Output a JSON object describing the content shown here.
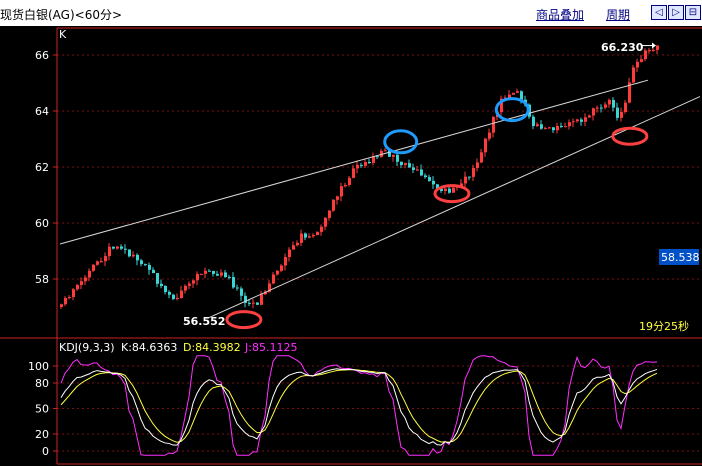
{
  "header": {
    "title": "现货白银(AG)<60分>",
    "overlay_label": "商品叠加",
    "period_label": "周期",
    "nav_left_icon": "◁",
    "nav_right_icon": "▷",
    "nav_fit_icon": "⊟"
  },
  "colors": {
    "background": "#000000",
    "up": "#ff3b3b",
    "down": "#3ad6d6",
    "axis": "#cc2222",
    "grid": "#7a1010",
    "channel": "#d8d8d8",
    "marker_red": "#ff4040",
    "marker_blue": "#1e9bff",
    "k_line": "#ffffff",
    "d_line": "#ffff40",
    "j_line": "#ff30ff",
    "price_box": "#0050c8"
  },
  "chart_data": [
    {
      "type": "candlestick",
      "panel_label": "K",
      "y_ticks": [
        58,
        60,
        62,
        64,
        66
      ],
      "ylim": [
        56.3,
        66.6
      ],
      "grid": true,
      "bar_count": 150,
      "close_path": [
        [
          0,
          57.0
        ],
        [
          6,
          57.9
        ],
        [
          12,
          58.6
        ],
        [
          17,
          59.2
        ],
        [
          21,
          59.0
        ],
        [
          27,
          58.6
        ],
        [
          33,
          57.8
        ],
        [
          37,
          57.2
        ],
        [
          41,
          57.6
        ],
        [
          46,
          58.3
        ],
        [
          52,
          58.2
        ],
        [
          56,
          58.0
        ],
        [
          60,
          57.5
        ],
        [
          63,
          57.0
        ],
        [
          66,
          57.2
        ],
        [
          70,
          58.0
        ],
        [
          75,
          58.8
        ],
        [
          80,
          59.5
        ],
        [
          86,
          59.6
        ],
        [
          92,
          61.0
        ],
        [
          98,
          62.0
        ],
        [
          103,
          62.2
        ],
        [
          108,
          62.6
        ],
        [
          113,
          62.2
        ],
        [
          120,
          61.8
        ],
        [
          126,
          61.2
        ],
        [
          131,
          61.2
        ],
        [
          137,
          61.8
        ],
        [
          142,
          63.0
        ],
        [
          146,
          64.2
        ],
        [
          149,
          64.6
        ],
        [
          153,
          64.6
        ],
        [
          157,
          63.6
        ],
        [
          162,
          63.3
        ],
        [
          170,
          63.5
        ],
        [
          178,
          64.0
        ],
        [
          183,
          64.4
        ],
        [
          186,
          63.6
        ],
        [
          188,
          64.2
        ],
        [
          191,
          65.6
        ],
        [
          195,
          66.1
        ],
        [
          199,
          66.23
        ]
      ],
      "channel": {
        "upper": {
          "start": [
            0,
            59.25
          ],
          "end": [
            195,
            65.1
          ]
        },
        "lower": {
          "start": [
            49,
            56.6
          ],
          "end": [
            199,
            63.8
          ]
        }
      },
      "markers": [
        {
          "kind": "red-ellipse",
          "at": [
            61,
            56.55
          ]
        },
        {
          "kind": "blue-ellipse",
          "at": [
            113,
            62.9
          ]
        },
        {
          "kind": "red-ellipse",
          "at": [
            130,
            61.05
          ]
        },
        {
          "kind": "blue-ellipse",
          "at": [
            150,
            64.05
          ]
        },
        {
          "kind": "red-ellipse",
          "at": [
            189,
            63.1
          ]
        }
      ],
      "annotations": {
        "low_value": "56.552",
        "high_value": "66.230",
        "current_price": "58.538",
        "countdown": "19分25秒"
      }
    },
    {
      "type": "line",
      "panel_label": "KDJ(9,3,3)",
      "y_ticks": [
        0,
        20,
        50,
        80,
        100
      ],
      "ylim": [
        -5,
        110
      ],
      "series": [
        {
          "name": "K",
          "label": "K:84.6363",
          "key": "K"
        },
        {
          "name": "D",
          "label": "D:84.3982",
          "key": "D"
        },
        {
          "name": "J",
          "label": "J:85.1125",
          "key": "J"
        }
      ]
    }
  ]
}
